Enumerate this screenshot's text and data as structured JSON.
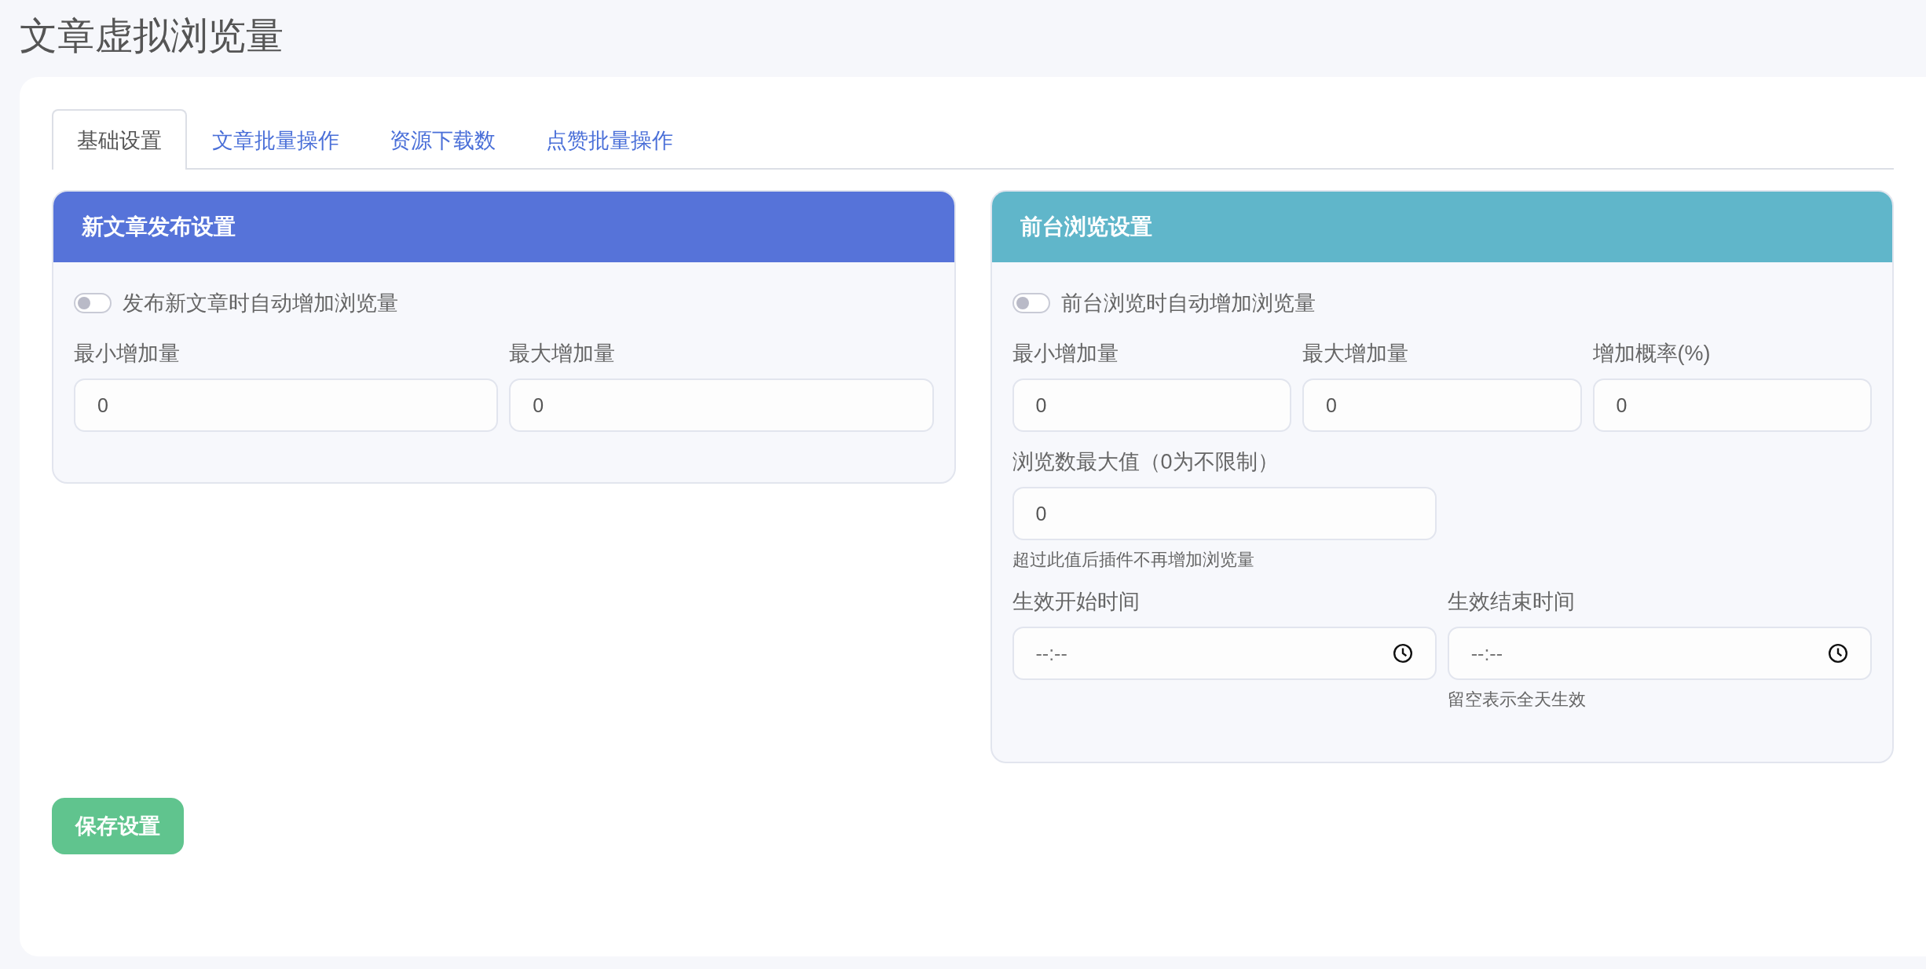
{
  "page_title": "文章虚拟浏览量",
  "tabs": [
    {
      "label": "基础设置",
      "selected": true
    },
    {
      "label": "文章批量操作",
      "selected": false
    },
    {
      "label": "资源下载数",
      "selected": false
    },
    {
      "label": "点赞批量操作",
      "selected": false
    }
  ],
  "panels": [
    {
      "title": "新文章发布设置",
      "color": "#5673d9",
      "toggle": {
        "label": "发布新文章时自动增加浏览量",
        "on": false
      },
      "rows": [
        {
          "fields": [
            {
              "kind": "number",
              "label": "最小增加量",
              "value": "0"
            },
            {
              "kind": "number",
              "label": "最大增加量",
              "value": "0"
            }
          ]
        }
      ]
    },
    {
      "title": "前台浏览设置",
      "color": "#60b6ca",
      "toggle": {
        "label": "前台浏览时自动增加浏览量",
        "on": false
      },
      "rows": [
        {
          "fields": [
            {
              "kind": "number",
              "label": "最小增加量",
              "value": "0"
            },
            {
              "kind": "number",
              "label": "最大增加量",
              "value": "0"
            },
            {
              "kind": "number",
              "label": "增加概率(%)",
              "value": "0"
            }
          ]
        },
        {
          "fields": [
            {
              "kind": "number",
              "label": "浏览数最大值（0为不限制）",
              "value": "0",
              "hint": "超过此值后插件不再增加浏览量"
            }
          ]
        },
        {
          "fields": [
            {
              "kind": "time",
              "label": "生效开始时间",
              "placeholder": "--:--"
            },
            {
              "kind": "time",
              "label": "生效结束时间",
              "placeholder": "--:--",
              "hint": "留空表示全天生效"
            }
          ]
        }
      ]
    }
  ],
  "save_button": "保存设置"
}
